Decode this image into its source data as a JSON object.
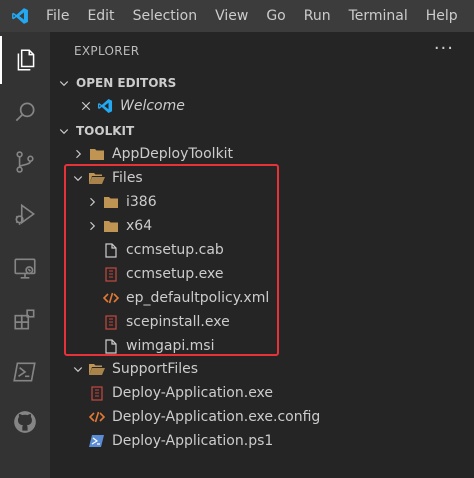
{
  "menu": [
    "File",
    "Edit",
    "Selection",
    "View",
    "Go",
    "Run",
    "Terminal",
    "Help"
  ],
  "activity_icons": [
    "explorer-icon",
    "search-icon",
    "source-control-icon",
    "run-debug-icon",
    "remote-explorer-icon",
    "extensions-icon",
    "powershell-icon",
    "github-icon"
  ],
  "explorer": {
    "title": "EXPLORER",
    "more": "···",
    "open_editors": {
      "label": "OPEN EDITORS",
      "items": [
        {
          "name": "Welcome"
        }
      ]
    },
    "workspace": {
      "label": "TOOLKIT",
      "tree": [
        {
          "name": "AppDeployToolkit",
          "type": "folder",
          "expanded": false
        },
        {
          "name": "Files",
          "type": "folder",
          "expanded": true
        },
        {
          "name": "i386",
          "type": "folder",
          "expanded": false
        },
        {
          "name": "x64",
          "type": "folder",
          "expanded": false
        },
        {
          "name": "ccmsetup.cab",
          "type": "file"
        },
        {
          "name": "ccmsetup.exe",
          "type": "exe"
        },
        {
          "name": "ep_defaultpolicy.xml",
          "type": "xml"
        },
        {
          "name": "scepinstall.exe",
          "type": "exe"
        },
        {
          "name": "wimgapi.msi",
          "type": "file"
        },
        {
          "name": "SupportFiles",
          "type": "folder",
          "expanded": true
        },
        {
          "name": "Deploy-Application.exe",
          "type": "exe"
        },
        {
          "name": "Deploy-Application.exe.config",
          "type": "xml"
        },
        {
          "name": "Deploy-Application.ps1",
          "type": "ps1"
        }
      ]
    }
  },
  "colors": {
    "highlight": "#e8323a",
    "folder": "#c09553",
    "exe": "#c5483f",
    "xml": "#e37933",
    "ps1": "#5b8dd6",
    "vscode_blue": "#23a9f2"
  }
}
